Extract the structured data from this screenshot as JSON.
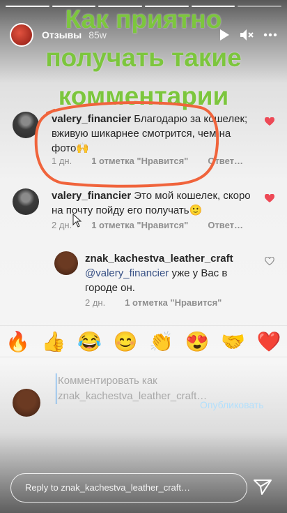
{
  "story": {
    "account_name": "Отзывы",
    "time_ago": "85w",
    "overlay_lines": [
      "Как приятно",
      "получать такие",
      "комментарии"
    ]
  },
  "header_icons": [
    "play-icon",
    "mute-icon",
    "more-icon"
  ],
  "comments": [
    {
      "username": "valery_financier",
      "text": "Благодарю за кошелек; вживую шикарнее смотрится, чем на фото🙌",
      "age": "1 дн.",
      "likes": "1 отметка \"Нравится\"",
      "reply": "Ответ…",
      "liked": true
    },
    {
      "username": "valery_financier",
      "text": "Это мой кошелек, скоро на почту пойду его получать🙂",
      "age": "2 дн.",
      "likes": "1 отметка \"Нравится\"",
      "reply": "Ответ…",
      "liked": true
    }
  ],
  "reply_comment": {
    "username": "znak_kachestva_leather_craft",
    "mention": "@valery_financier",
    "text": "уже у Вас в городе он.",
    "age": "2 дн.",
    "likes": "1 отметка \"Нравится\"",
    "liked": false
  },
  "emoji_bar": [
    "🔥",
    "👍",
    "😂",
    "😊",
    "👏",
    "😍",
    "🤝",
    "❤️"
  ],
  "compose": {
    "placeholder": "Комментировать как znak_kachestva_leather_craft…",
    "publish_label": "Опубликовать"
  },
  "reply_bar": {
    "placeholder": "Reply to znak_kachestva_leather_craft…"
  },
  "colors": {
    "overlay_green": "#7cc63d",
    "heart_red": "#ed4956",
    "highlight_orange": "#f0643c",
    "link_blue": "#385185"
  }
}
